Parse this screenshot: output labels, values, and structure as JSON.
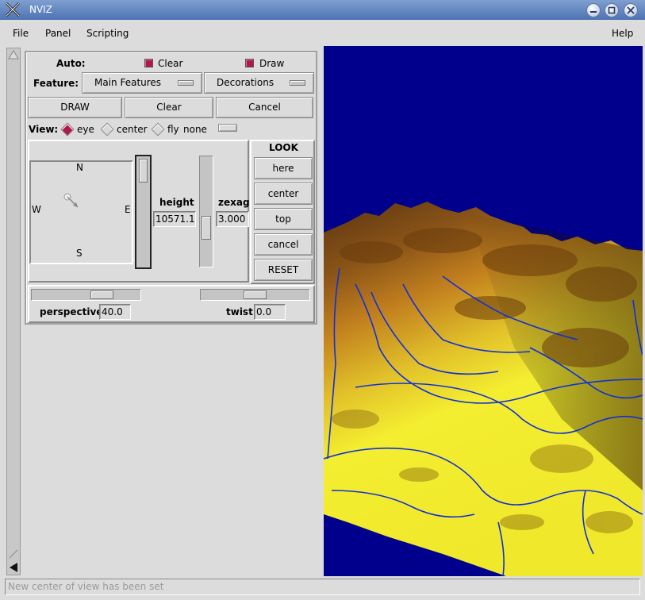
{
  "window": {
    "title": "NVIZ",
    "icon": "x-app-icon"
  },
  "menubar": {
    "file": "File",
    "panel": "Panel",
    "scripting": "Scripting",
    "help": "Help"
  },
  "auto": {
    "label": "Auto:",
    "clear_label": "Clear",
    "clear_checked": true,
    "draw_label": "Draw",
    "draw_checked": true
  },
  "feature": {
    "label": "Feature:",
    "main_features": "Main Features",
    "decorations": "Decorations"
  },
  "actions": {
    "draw": "DRAW",
    "clear": "Clear",
    "cancel": "Cancel"
  },
  "view": {
    "label": "View:",
    "options": [
      "eye",
      "center",
      "fly"
    ],
    "selected": "eye",
    "fly_mode": "none"
  },
  "compass": {
    "n": "N",
    "e": "E",
    "s": "S",
    "w": "W"
  },
  "height": {
    "label": "height",
    "value": "10571.10"
  },
  "zexag": {
    "label": "zexag",
    "value": "3.000"
  },
  "look": {
    "label": "LOOK",
    "buttons": [
      "here",
      "center",
      "top",
      "cancel",
      "RESET"
    ]
  },
  "perspective": {
    "label": "perspective",
    "value": "40.0"
  },
  "twist": {
    "label": "twist",
    "value": "0.0"
  },
  "status": {
    "message": "New center of view has been set"
  },
  "colors": {
    "canvas_bg": "#00008c",
    "titlebar": "#5b80bd",
    "check": "#b01848"
  }
}
